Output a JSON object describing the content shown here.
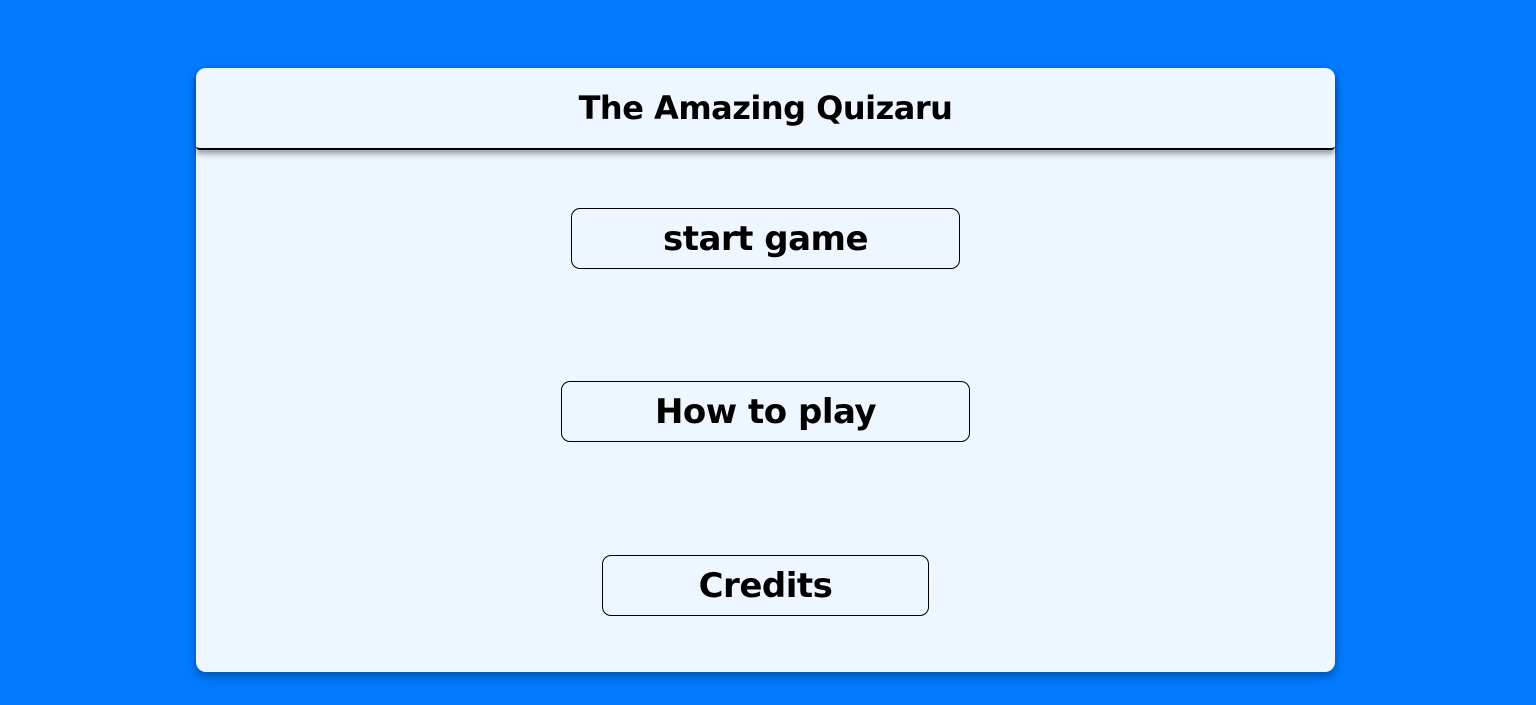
{
  "header": {
    "title": "The Amazing Quizaru"
  },
  "menu": {
    "start_label": "start game",
    "how_to_play_label": "How to play",
    "credits_label": "Credits"
  },
  "colors": {
    "background": "#007bff",
    "panel": "#eef6ff",
    "text": "#000000"
  }
}
